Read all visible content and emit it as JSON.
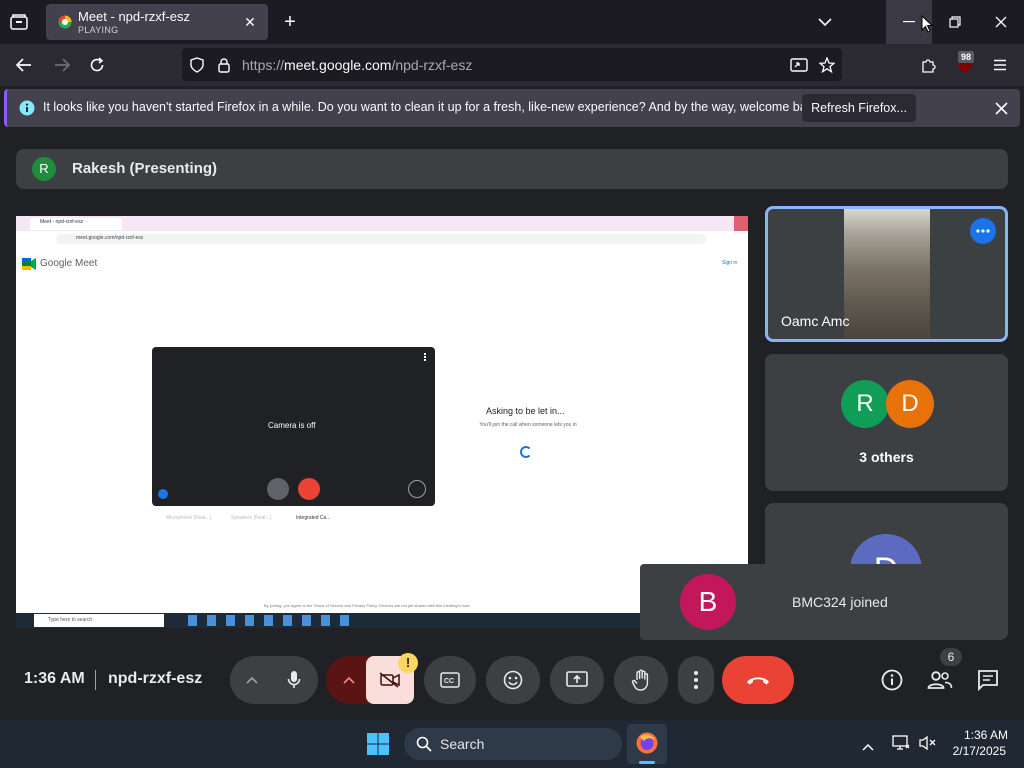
{
  "browser": {
    "tab": {
      "title": "Meet - npd-rzxf-esz",
      "status": "PLAYING"
    },
    "url": {
      "prefix": "https://",
      "host": "meet.google.com",
      "path": "/npd-rzxf-esz"
    },
    "extension_badge": "98"
  },
  "notification": {
    "message": "It looks like you haven't started Firefox in a while. Do you want to clean it up for a fresh, like-new experience? And by the way, welcome back!",
    "button_label": "Refresh Firefox..."
  },
  "meet": {
    "presenter": {
      "initial": "R",
      "label": "Rakesh (Presenting)"
    },
    "shared_screen": {
      "tab_title": "Meet - npd-rzxf-esz",
      "url": "meet.google.com/npd-rzxf-esz",
      "brand": "Google Meet",
      "sign_in": "Sign in",
      "camera_off": "Camera is off",
      "asking_title": "Asking to be let in...",
      "asking_sub": "You'll join the call when someone lets you in",
      "mic_device": "Microphone (Real...)",
      "speaker_device": "Speakers (Real...)",
      "camera_device": "Integrated Ca...",
      "footer": "By joining, you agree to the Terms of Service and Privacy Policy. Devices are not yet shared with this meeting's host.",
      "taskbar_search": "Type here to search"
    },
    "tiles": [
      {
        "name": "Oamc Amc"
      },
      {
        "initials": [
          "R",
          "D"
        ],
        "label": "3 others"
      },
      {
        "initial": "D"
      }
    ],
    "toast": {
      "initial": "B",
      "message": "BMC324 joined"
    },
    "bottom": {
      "time": "1:36 AM",
      "meeting_code": "npd-rzxf-esz",
      "people_count": "6",
      "camera_alert": "!"
    }
  },
  "taskbar": {
    "search_label": "Search",
    "time": "1:36 AM",
    "date": "2/17/2025"
  },
  "colors": {
    "accent_blue": "#8ab4f8",
    "meet_red": "#ea4335",
    "green_avatar": "#1e8e3e",
    "teal_avatar": "#0f9d58",
    "orange_avatar": "#e8710a",
    "pink_avatar": "#c2185b",
    "purple_avatar": "#5c6bc0"
  }
}
